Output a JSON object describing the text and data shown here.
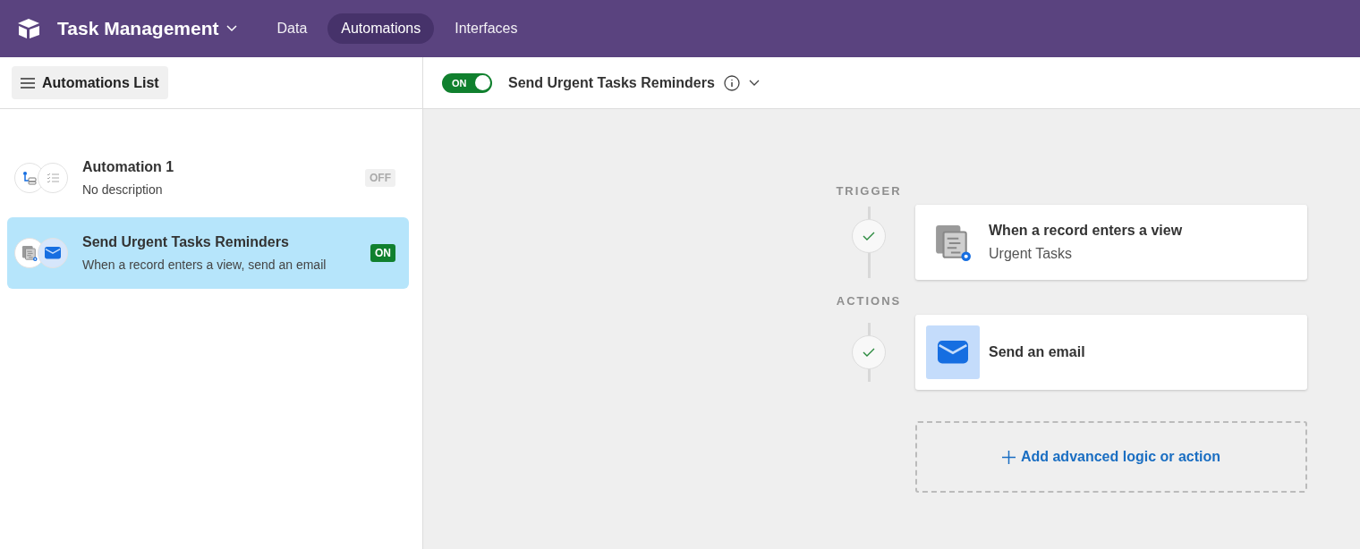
{
  "app": {
    "title": "Task Management"
  },
  "nav_tabs": [
    {
      "label": "Data",
      "selected": false
    },
    {
      "label": "Automations",
      "selected": true
    },
    {
      "label": "Interfaces",
      "selected": false
    }
  ],
  "sidebar": {
    "list_button": "Automations List",
    "automations": [
      {
        "name": "Automation 1",
        "description": "No description",
        "status": "OFF",
        "on": false,
        "selected": false,
        "kind": "blank"
      },
      {
        "name": "Send Urgent Tasks Reminders",
        "description": "When a record enters a view, send an email",
        "status": "ON",
        "on": true,
        "selected": true,
        "kind": "email"
      }
    ]
  },
  "editor": {
    "toggle": {
      "label": "ON",
      "on": true
    },
    "title": "Send Urgent Tasks Reminders"
  },
  "flow": {
    "sections": [
      {
        "heading": "TRIGGER",
        "steps": [
          {
            "kind": "view",
            "title": "When a record enters a view",
            "subtitle": "Urgent Tasks",
            "done": true
          }
        ]
      },
      {
        "heading": "ACTIONS",
        "steps": [
          {
            "kind": "email",
            "title": "Send an email",
            "done": true
          }
        ]
      }
    ],
    "add_button": "Add advanced logic or action"
  }
}
